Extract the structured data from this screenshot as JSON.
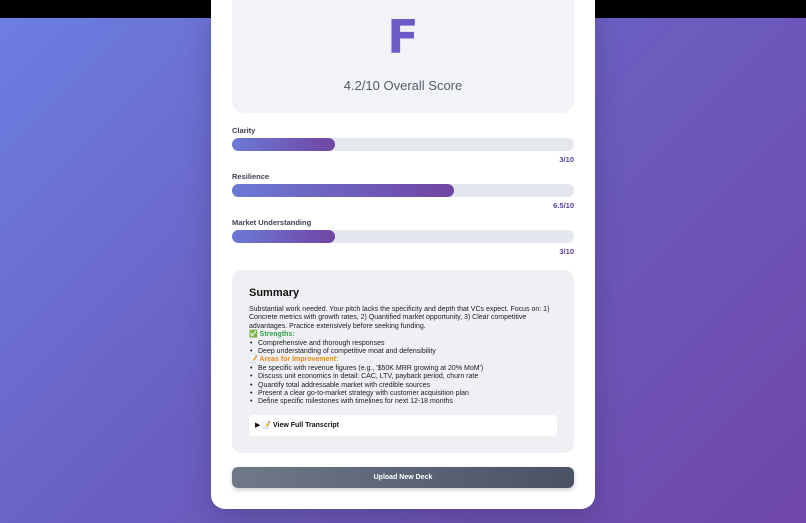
{
  "score": {
    "grade": "F",
    "overall": "4.2/10 Overall Score"
  },
  "metrics": [
    {
      "label": "Clarity",
      "value": "3/10",
      "fraction": 0.3
    },
    {
      "label": "Resilience",
      "value": "6.5/10",
      "fraction": 0.65
    },
    {
      "label": "Market Understanding",
      "value": "3/10",
      "fraction": 0.3
    }
  ],
  "summary": {
    "title": "Summary",
    "intro": "Substantial work needed. Your pitch lacks the specificity and depth that VCs expect. Focus on: 1) Concrete metrics with growth rates, 2) Quantified market opportunity, 3) Clear competitive advantages. Practice extensively before seeking funding.",
    "strengths_head": "✅ Strengths:",
    "strengths": [
      "Comprehensive and thorough responses",
      "Deep understanding of competitive moat and defensibility"
    ],
    "improve_head": "📝 Areas for Improvement:",
    "improvements": [
      "Be specific with revenue figures (e.g., '$50K MRR growing at 20% MoM')",
      "Discuss unit economics in detail: CAC, LTV, payback period, churn rate",
      "Quantify total addressable market with credible sources",
      "Present a clear go-to-market strategy with customer acquisition plan",
      "Define specific milestones with timelines for next 12-18 months"
    ],
    "transcript_label": "▶ 📝 View Full Transcript"
  },
  "upload_button": "Upload New Deck",
  "colors": {
    "accent": "#6a5bc6",
    "bar_start": "#6c7ad6",
    "bar_end": "#7045a3",
    "strength": "#36a24b",
    "improvement": "#e58a25"
  }
}
